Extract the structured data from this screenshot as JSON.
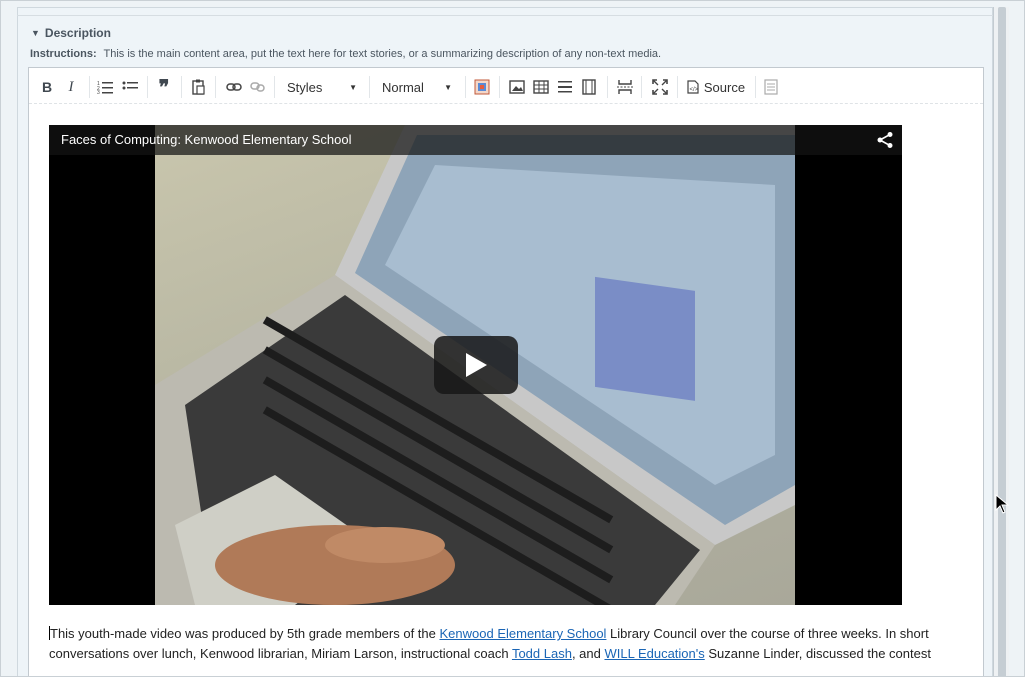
{
  "section": {
    "title": "Description",
    "instructions_label": "Instructions:",
    "instructions_text": "This is the main content area, put the text here for text stories, or a summarizing description of any non-text media."
  },
  "toolbar": {
    "bold_label": "B",
    "italic_label": "I",
    "styles_label": "Styles",
    "format_label": "Normal",
    "source_label": "Source"
  },
  "video": {
    "title": "Faces of Computing: Kenwood Elementary School"
  },
  "body": {
    "p1_a": "This youth-made video was produced by 5th grade members of the ",
    "link1": "Kenwood Elementary School",
    "p1_b": " Library Council over the course of three weeks. In short conversations over lunch, Kenwood librarian, Miriam Larson, instructional coach ",
    "link2": "Todd Lash",
    "p1_c": ", and ",
    "link3": "WILL Education's",
    "p1_d": "  Suzanne Linder, discussed the contest"
  },
  "colors": {
    "link": "#1a65b5",
    "panel_bg": "#eef4f8"
  }
}
